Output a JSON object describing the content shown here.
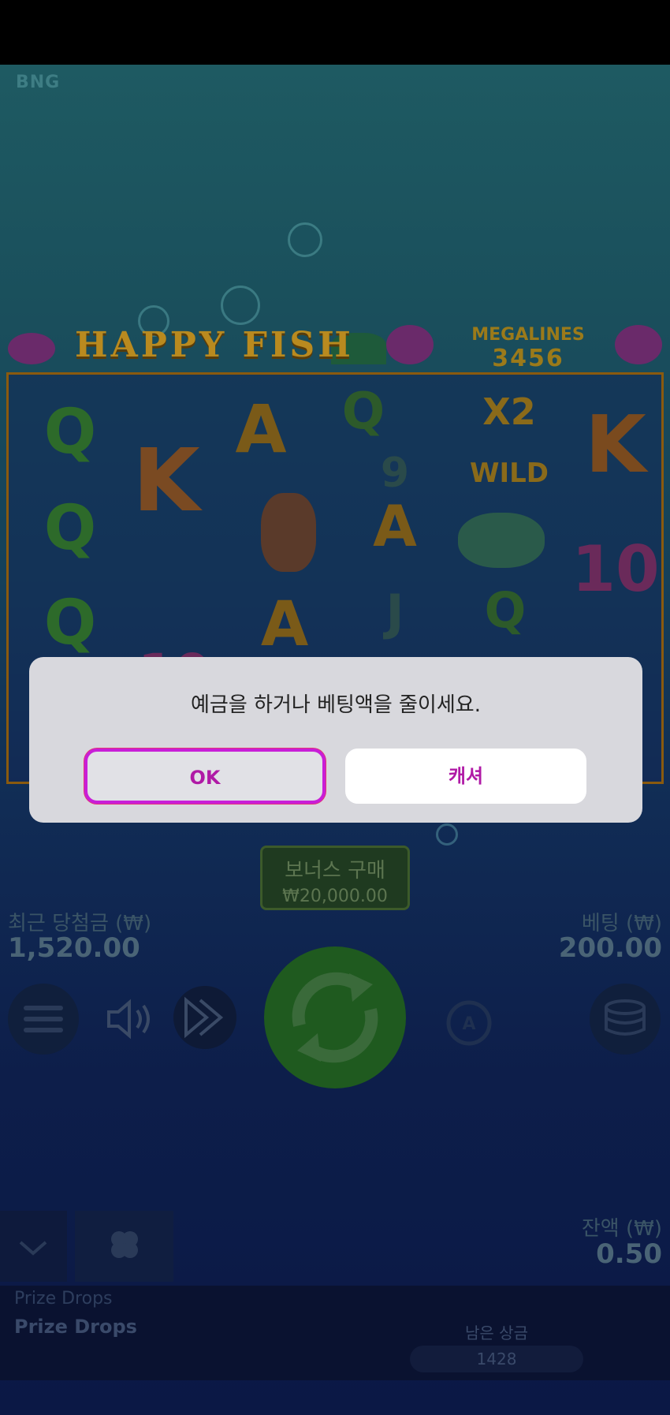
{
  "brand": "BNG",
  "game": {
    "title": "HAPPY FISH",
    "megalines_label": "MEGALINES",
    "megalines_value": "3456"
  },
  "reels": {
    "symbols": [
      "Q",
      "K",
      "A",
      "Q",
      "X2",
      "K",
      "Q",
      "A",
      "9",
      "WILD",
      "10",
      "Q",
      "A",
      "J",
      "Q",
      "10"
    ]
  },
  "bonus_buy": {
    "label": "보너스 구매",
    "price": "₩20,000.00"
  },
  "last_win": {
    "label": "최근 당첨금 (₩)",
    "value": "1,520.00"
  },
  "bet": {
    "label": "베팅 (₩)",
    "value": "200.00"
  },
  "balance": {
    "label": "잔액 (₩)",
    "value": "0.50"
  },
  "prize_drops": {
    "title_small": "Prize Drops",
    "title": "Prize Drops",
    "remaining_label": "남은 상금",
    "remaining_value": "1428"
  },
  "icons": [
    "menu-icon",
    "sound-icon",
    "turbo-icon",
    "spin-icon",
    "autoplay-icon",
    "coins-icon",
    "chevron-down-icon",
    "clover-icon"
  ],
  "dialog": {
    "message": "예금을 하거나 베팅액을 줄이세요.",
    "ok_label": "OK",
    "cashier_label": "캐셔"
  },
  "colors": {
    "accent": "#c81ed8",
    "button_text": "#b01aa6",
    "dialog_bg": "#d8d8dd"
  }
}
